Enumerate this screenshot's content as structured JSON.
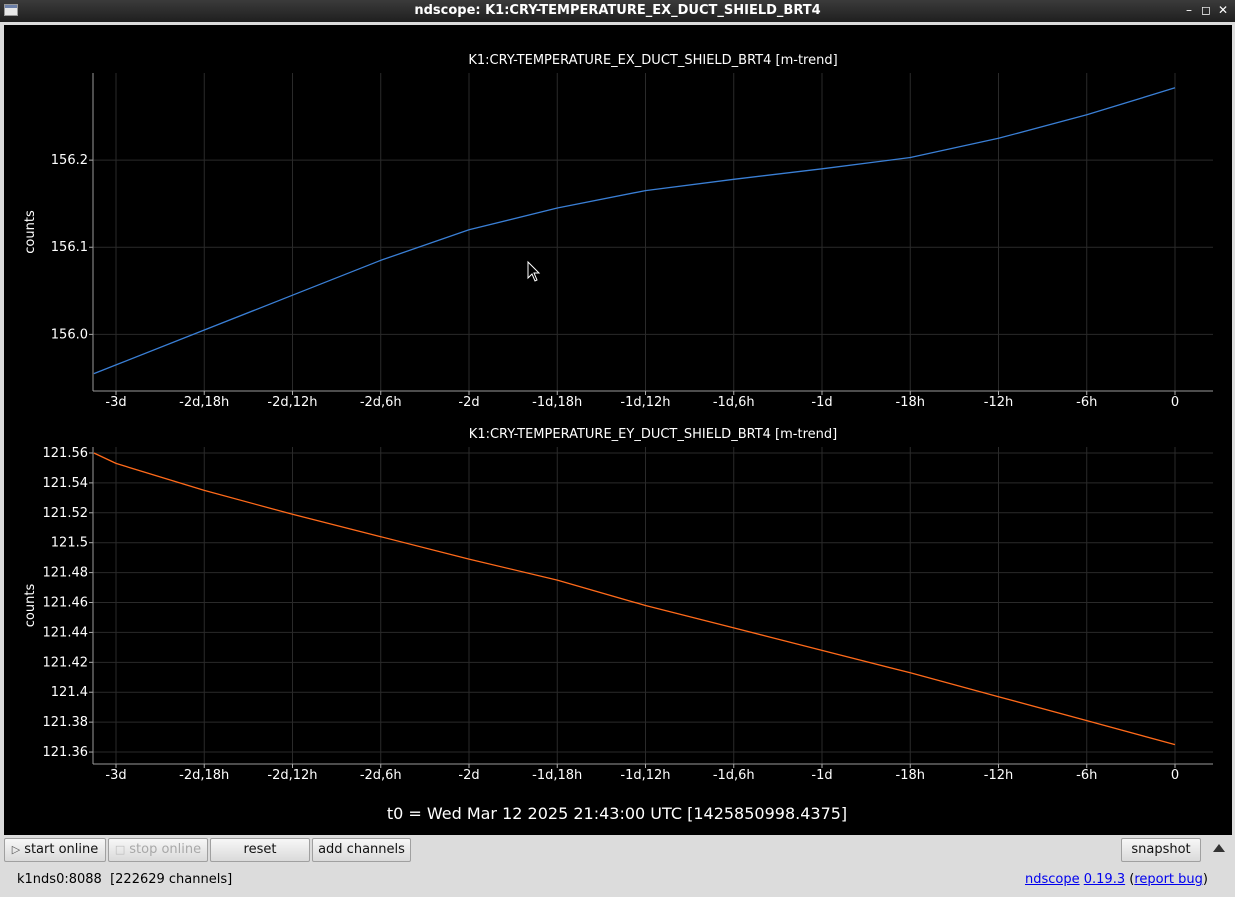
{
  "window": {
    "title": "ndscope: K1:CRY-TEMPERATURE_EX_DUCT_SHIELD_BRT4",
    "controls": [
      "–",
      "◻",
      "✕"
    ]
  },
  "x_tick_labels": [
    "-3d",
    "-2d,18h",
    "-2d,12h",
    "-2d,6h",
    "-2d",
    "-1d,18h",
    "-1d,12h",
    "-1d,6h",
    "-1d",
    "-18h",
    "-12h",
    "-6h",
    "0"
  ],
  "t0_label": "t0 = Wed Mar 12 2025 21:43:00 UTC [1425850998.4375]",
  "colors": {
    "series1": "#3a7fd5",
    "series2": "#ff6a1a",
    "background": "#000000",
    "grid": "#2a2a2a"
  },
  "chart_data": [
    {
      "type": "line",
      "title": "K1:CRY-TEMPERATURE_EX_DUCT_SHIELD_BRT4 [m-trend]",
      "ylabel": "counts",
      "xlabel": "",
      "x_unit": "hours relative to t0",
      "x_ticks": [
        -72,
        -66,
        -60,
        -54,
        -48,
        -42,
        -36,
        -30,
        -24,
        -18,
        -12,
        -6,
        0
      ],
      "ylim": [
        155.935,
        156.3
      ],
      "y_ticks": [
        156.0,
        156.1,
        156.2
      ],
      "y_tick_labels": [
        "156.0",
        "156.1",
        "156.2"
      ],
      "grid": true,
      "series": [
        {
          "x": [
            -73.5,
            -72,
            -66,
            -60,
            -54,
            -48,
            -42,
            -36,
            -30,
            -24,
            -18,
            -12,
            -6,
            0
          ],
          "y": [
            155.955,
            155.965,
            156.005,
            156.045,
            156.085,
            156.12,
            156.145,
            156.165,
            156.178,
            156.19,
            156.203,
            156.225,
            156.252,
            156.283
          ]
        }
      ]
    },
    {
      "type": "line",
      "title": "K1:CRY-TEMPERATURE_EY_DUCT_SHIELD_BRT4 [m-trend]",
      "ylabel": "counts",
      "xlabel": "",
      "x_unit": "hours relative to t0",
      "x_ticks": [
        -72,
        -66,
        -60,
        -54,
        -48,
        -42,
        -36,
        -30,
        -24,
        -18,
        -12,
        -6,
        0
      ],
      "ylim": [
        121.352,
        121.564
      ],
      "y_ticks": [
        121.36,
        121.38,
        121.4,
        121.42,
        121.44,
        121.46,
        121.48,
        121.5,
        121.52,
        121.54,
        121.56
      ],
      "y_tick_labels": [
        "121.36",
        "121.38",
        "121.4",
        "121.42",
        "121.44",
        "121.46",
        "121.48",
        "121.5",
        "121.52",
        "121.54",
        "121.56"
      ],
      "grid": true,
      "series": [
        {
          "x": [
            -73.5,
            -72,
            -66,
            -60,
            -54,
            -48,
            -42,
            -36,
            -30,
            -24,
            -18,
            -12,
            -6,
            0
          ],
          "y": [
            121.56,
            121.553,
            121.535,
            121.519,
            121.504,
            121.489,
            121.475,
            121.458,
            121.443,
            121.428,
            121.413,
            121.397,
            121.381,
            121.365
          ]
        }
      ]
    }
  ],
  "buttons": {
    "start_online": "start online",
    "stop_online": "stop online",
    "reset": "reset",
    "add_channels": "add channels",
    "snapshot": "snapshot"
  },
  "status": {
    "server": "k1nds0:8088",
    "channels": "[222629 channels]",
    "app_link": "ndscope",
    "version_link": "0.19.3",
    "report_link": "report bug"
  }
}
